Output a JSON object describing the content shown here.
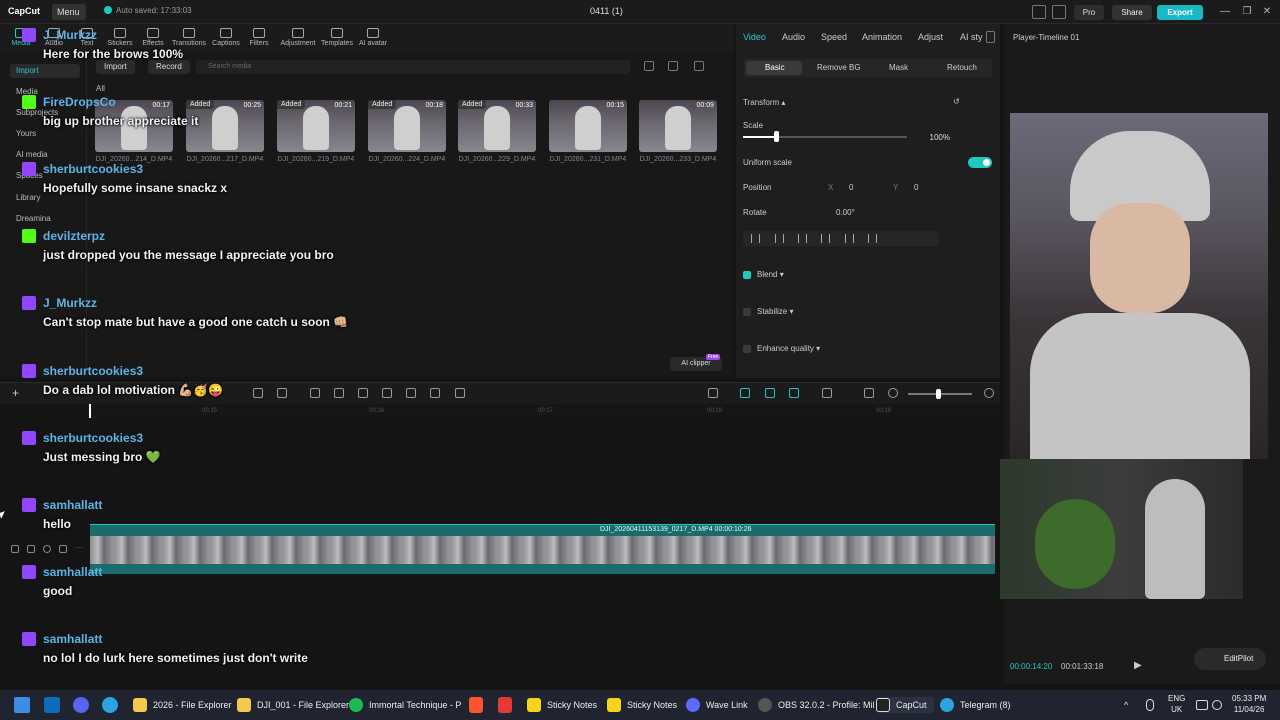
{
  "titlebar": {
    "app_name": "CapCut",
    "menu_label": "Menu",
    "autosave": "Auto saved: 17:33:03",
    "project_title": "0411 (1)",
    "pro_label": "Pro",
    "share_label": "Share",
    "export_label": "Export"
  },
  "toolbar": {
    "tools": [
      "Media",
      "Audio",
      "Text",
      "Stickers",
      "Effects",
      "Transitions",
      "Captions",
      "Filters",
      "Adjustment",
      "Templates",
      "AI avatar"
    ]
  },
  "leftnav": {
    "items": [
      "Import",
      "Media",
      "Subprojects",
      "Yours",
      "AI media",
      "Spaces",
      "Library",
      "Dreamina"
    ]
  },
  "media": {
    "import_label": "Import",
    "record_label": "Record",
    "search_placeholder": "Search media",
    "all_label": "All",
    "added_label": "Added",
    "clips": [
      {
        "name": "DJI_20260...214_D.MP4",
        "duration": "00:17"
      },
      {
        "name": "DJI_20260...217_D.MP4",
        "duration": "00:25"
      },
      {
        "name": "DJI_20260...219_D.MP4",
        "duration": "00:21"
      },
      {
        "name": "DJI_20260...224_D.MP4",
        "duration": "00:18"
      },
      {
        "name": "DJI_20260...229_D.MP4",
        "duration": "00:33"
      },
      {
        "name": "DJI_20260...231_D.MP4",
        "duration": "00:15"
      },
      {
        "name": "DJI_20260...233_D.MP4",
        "duration": "00:09"
      }
    ],
    "ai_clipper_label": "AI clipper",
    "free_tag": "Free"
  },
  "props": {
    "tabs": [
      "Video",
      "Audio",
      "Speed",
      "Animation",
      "Adjust",
      "AI sty"
    ],
    "subtabs": [
      "Basic",
      "Remove BG",
      "Mask",
      "Retouch"
    ],
    "transform_label": "Transform",
    "scale_label": "Scale",
    "scale_value": "100%",
    "scale_fraction": 0.2,
    "uniform_scale_label": "Uniform scale",
    "position_label": "Position",
    "pos_x_label": "X",
    "pos_x": "0",
    "pos_y_label": "Y",
    "pos_y": "0",
    "rotate_label": "Rotate",
    "rotate_value": "0.00°",
    "blend_label": "Blend",
    "stabilize_label": "Stabilize",
    "enhance_label": "Enhance quality"
  },
  "player": {
    "title": "Player-Timeline 01",
    "current_time": "00:00:14:20",
    "total_time": "00:01:33:18",
    "editpilot_label": "EditPilot"
  },
  "timeline": {
    "ticks": [
      "00:15",
      "00:16",
      "00:17",
      "00:18",
      "00:19"
    ],
    "clip_label": "DJI_20260411153139_0217_D.MP4   00:00:10:26"
  },
  "chat": [
    {
      "user": "J_Murkzz",
      "platform": "twitch",
      "text": "Here for the brows 100%"
    },
    {
      "user": "FireDropsCo",
      "platform": "kick",
      "text": "big up brother appreciate it"
    },
    {
      "user": "sherburtcookies3",
      "platform": "twitch",
      "text": "Hopefully some insane snackz x"
    },
    {
      "user": "devilzterpz",
      "platform": "kick",
      "text": "just dropped you the message I appreciate you bro"
    },
    {
      "user": "J_Murkzz",
      "platform": "twitch",
      "text": "Can't stop mate but have a good one catch u soon 👊🏼"
    },
    {
      "user": "sherburtcookies3",
      "platform": "twitch",
      "text": "Do a dab lol motivation 💪🏼🥳😜"
    },
    {
      "user": "sherburtcookies3",
      "platform": "twitch",
      "text": "Just messing bro 💚"
    },
    {
      "user": "samhallatt",
      "platform": "twitch",
      "text": "hello"
    },
    {
      "user": "samhallatt",
      "platform": "twitch",
      "text": "good"
    },
    {
      "user": "samhallatt",
      "platform": "twitch",
      "text": "no lol I do lurk here sometimes just don't write"
    }
  ],
  "taskbar": {
    "items": [
      {
        "label": "2026 - File Explorer",
        "color": "#f2c94c"
      },
      {
        "label": "DJI_001 - File Explorer",
        "color": "#f2c94c"
      },
      {
        "label": "Immortal Technique - P",
        "color": "#1db954"
      },
      {
        "label": "Sticky Notes",
        "color": "#f7d51d"
      },
      {
        "label": "Sticky Notes",
        "color": "#f7d51d"
      },
      {
        "label": "Wave Link",
        "color": "#5b6cff"
      },
      {
        "label": "OBS 32.0.2 - Profile: Mil",
        "color": "#555555"
      },
      {
        "label": "CapCut",
        "color": "#222222"
      },
      {
        "label": "Telegram (8)",
        "color": "#2aa3e0"
      }
    ],
    "lang_top": "ENG",
    "lang_bottom": "UK",
    "time": "05:33 PM",
    "date": "11/04/26"
  }
}
